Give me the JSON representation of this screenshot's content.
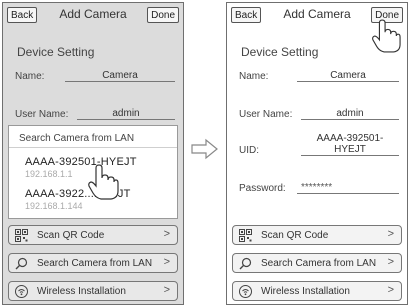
{
  "left": {
    "title": "Add Camera",
    "back_label": "Back",
    "done_label": "Done",
    "section_title": "Device Setting",
    "name_label": "Name:",
    "name_value": "Camera",
    "username_label": "User Name:",
    "username_value": "admin",
    "lan_panel": {
      "title": "Search Camera from LAN",
      "items": [
        {
          "name": "AAAA-392501-HYEJT",
          "ip": "192.168.1.1"
        },
        {
          "name": "AAAA-3922...HYRJT",
          "ip": "192.168.1.144"
        }
      ]
    },
    "buttons": [
      {
        "label": "Scan QR Code",
        "icon": "qr-code-icon"
      },
      {
        "label": "Search Camera from LAN",
        "icon": "magnifier-icon"
      },
      {
        "label": "Wireless Installation",
        "icon": "wireless-icon"
      }
    ]
  },
  "right": {
    "title": "Add Camera",
    "back_label": "Back",
    "done_label": "Done",
    "section_title": "Device Setting",
    "name_label": "Name:",
    "name_value": "Camera",
    "username_label": "User Name:",
    "username_value": "admin",
    "uid_label": "UID:",
    "uid_value": "AAAA-392501-HYEJT",
    "password_label": "Password:",
    "password_value": "********",
    "buttons": [
      {
        "label": "Scan QR Code",
        "icon": "qr-code-icon"
      },
      {
        "label": "Search Camera from LAN",
        "icon": "magnifier-icon"
      },
      {
        "label": "Wireless Installation",
        "icon": "wireless-icon"
      }
    ]
  },
  "colors": {
    "border": "#6f6f6f",
    "left_background": "#dcdcdc",
    "right_background": "#ffffff"
  }
}
